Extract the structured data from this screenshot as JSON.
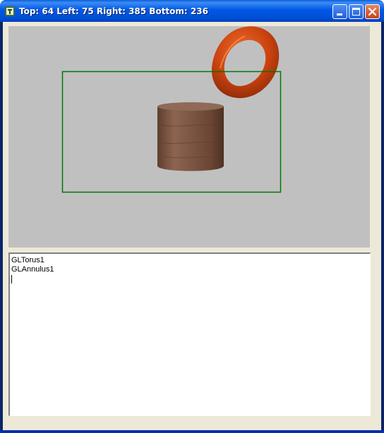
{
  "window": {
    "title": "Top: 64 Left: 75 Right: 385 Bottom: 236",
    "buttons": [
      "minimize-button",
      "maximize-button",
      "close-button"
    ]
  },
  "viewport": {
    "background": "#C0C0C0",
    "selection_rect_color": "#007700",
    "objects": [
      "torus",
      "cylinder"
    ]
  },
  "memo": {
    "lines": [
      "GLTorus1",
      "GLAnnulus1"
    ]
  },
  "colors": {
    "titlebar": "#0058E6",
    "client": "#ECE9D8",
    "close_button": "#C8421B"
  }
}
